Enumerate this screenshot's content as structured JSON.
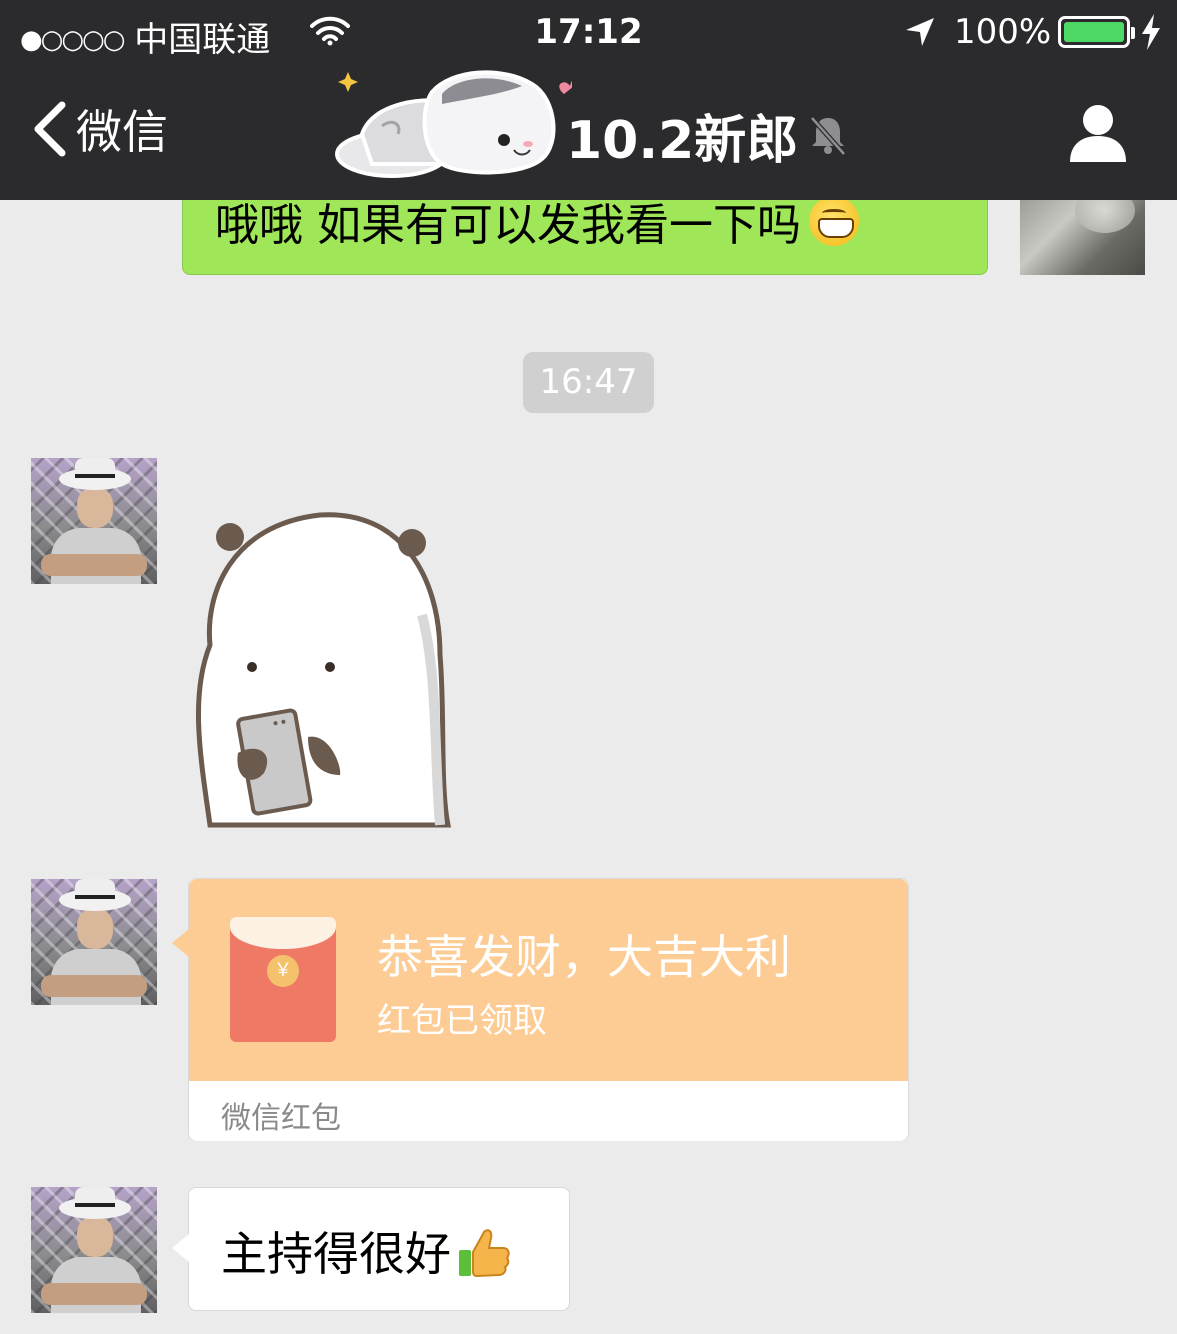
{
  "status_bar": {
    "signal": "●○○○○",
    "carrier": "中国联通",
    "time": "17:12",
    "battery_percent": "100%",
    "battery_level": 1.0,
    "icons": [
      "wifi-icon",
      "location-arrow-icon",
      "battery-icon",
      "charging-bolt-icon"
    ]
  },
  "nav": {
    "back_label": "微信",
    "title": "10.2新郎",
    "icons": [
      "back-chevron-icon",
      "sleeping-cat-sticker",
      "mute-bell-icon",
      "profile-icon"
    ]
  },
  "messages": {
    "outgoing_text": "哦哦 如果有可以发我看一下吗",
    "timestamp": "16:47",
    "red_packet": {
      "title": "恭喜发财，大吉大利",
      "status": "红包已领取",
      "footer": "微信红包",
      "coin_symbol": "￥"
    },
    "incoming_text": "主持得很好"
  },
  "colors": {
    "header_bg": "#2b2b2d",
    "chat_bg": "#ebebeb",
    "outgoing_bubble": "#9fe658",
    "red_packet_bg": "#fdcc94",
    "envelope": "#ee7a65",
    "battery_fill": "#4cd964"
  }
}
